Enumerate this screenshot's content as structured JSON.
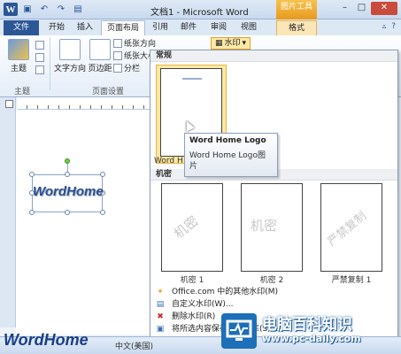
{
  "title_bar": {
    "doc_title": "文档1 - Microsoft Word",
    "picture_tools": "图片工具",
    "qat_icons": [
      "word-icon",
      "save-icon",
      "undo-icon",
      "redo-icon",
      "open-icon"
    ]
  },
  "tabs": {
    "file": "文件",
    "home": "开始",
    "insert": "插入",
    "page_layout": "页面布局",
    "references": "引用",
    "mailings": "邮件",
    "review": "审阅",
    "view": "视图",
    "format": "格式"
  },
  "ribbon": {
    "theme_label": "主题",
    "themes_group": "主题",
    "text_direction": "文字方向",
    "margins": "页边距",
    "page_setup_group": "页面设置",
    "orientation": "纸张方向",
    "size": "纸张大小",
    "columns": "分栏",
    "watermark": "水印"
  },
  "gallery": {
    "section_normal": "常规",
    "section_confidential": "机密",
    "thumb_selected_caption": "Word H",
    "thumb_selected_watermark": "Word Home",
    "items": [
      {
        "caption": "机密 1",
        "watermark": "机密"
      },
      {
        "caption": "机密 2",
        "watermark": "机密"
      },
      {
        "caption": "严禁复制 1",
        "watermark": "严禁复制"
      }
    ],
    "tooltip_title": "Word Home Logo",
    "tooltip_body": "Word Home Logo图片",
    "menu": [
      "Office.com 中的其他水印(M)",
      "自定义水印(W)...",
      "删除水印(R)",
      "将所选内容保存到水印库(S)..."
    ]
  },
  "document": {
    "wordart_text": "WordHome"
  },
  "status_bar": {
    "lang": "中文(美国)",
    "logo": "WordHome"
  },
  "site_watermark": {
    "name": "电脑百科知识",
    "url": "www.pc-daily.com"
  }
}
